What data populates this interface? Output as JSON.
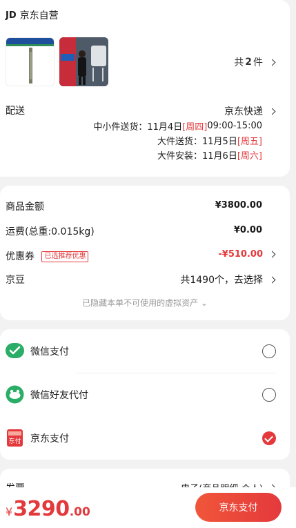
{
  "shop": {
    "logo": "JD",
    "name": "京东自营"
  },
  "goods": {
    "count_prefix": "共",
    "count": "2",
    "count_suffix": "件"
  },
  "delivery": {
    "label": "配送",
    "method": "京东快递",
    "lines": [
      {
        "label": "中小件送货：",
        "date": "11月4日",
        "weekday": "[周四]",
        "time": "09:00-15:00"
      },
      {
        "label": "大件送货：",
        "date": "11月5日",
        "weekday": "[周五]",
        "time": ""
      },
      {
        "label": "大件安装：",
        "date": "11月6日",
        "weekday": "[周六]",
        "time": ""
      }
    ]
  },
  "amount": {
    "goods_label": "商品金额",
    "goods_value": "¥3800.00",
    "freight_label": "运费(总重:0.015kg)",
    "freight_value": "¥0.00",
    "coupon_label": "优惠券",
    "coupon_tag": "已选推荐优惠",
    "coupon_value": "-¥510.00",
    "jingdou_label": "京豆",
    "jingdou_value": "共1490个，去选择",
    "hidden_note": "已隐藏本单不可使用的虚拟资产 ⌄"
  },
  "payment": {
    "options": [
      {
        "label": "微信支付",
        "icon": "wechat-pay-icon",
        "selected": false
      },
      {
        "label": "微信好友代付",
        "icon": "wechat-friend-pay-icon",
        "selected": false
      },
      {
        "label": "京东支付",
        "icon": "jd-pay-icon",
        "selected": true
      }
    ]
  },
  "invoice": {
    "label": "发票",
    "value": "电子(商品明细-个人)"
  },
  "footer": {
    "currency": "¥",
    "total_int": "3290",
    "total_dec": ".00",
    "pay_button": "京东支付"
  },
  "colors": {
    "accent": "#e4393c",
    "wechat_green": "#2aae67",
    "background": "#f2f2f2"
  }
}
